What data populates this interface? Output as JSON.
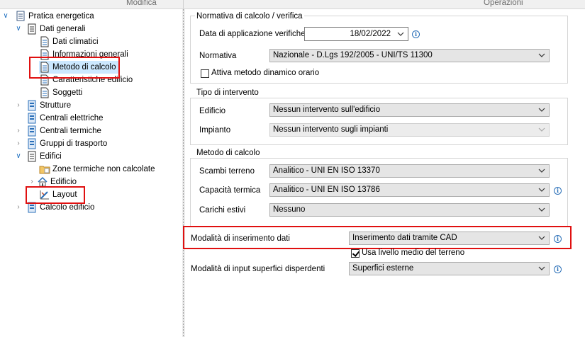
{
  "header": {
    "left_label": "Modifica",
    "right_label": "Operazioni"
  },
  "tree": {
    "items": [
      {
        "label": "Pratica energetica",
        "icon": "pratica-icon"
      },
      {
        "label": "Dati generali",
        "icon": "document-icon"
      },
      {
        "label": "Dati climatici",
        "icon": "document-icon"
      },
      {
        "label": "Informazioni generali",
        "icon": "document-icon"
      },
      {
        "label": "Metodo di calcolo",
        "icon": "document-icon"
      },
      {
        "label": "Caratteristiche edificio",
        "icon": "document-icon"
      },
      {
        "label": "Soggetti",
        "icon": "document-icon"
      },
      {
        "label": "Strutture",
        "icon": "module-icon"
      },
      {
        "label": "Centrali elettriche",
        "icon": "module-icon"
      },
      {
        "label": "Centrali termiche",
        "icon": "module-icon"
      },
      {
        "label": "Gruppi di trasporto",
        "icon": "module-icon"
      },
      {
        "label": "Edifici",
        "icon": "document-icon"
      },
      {
        "label": "Zone termiche non calcolate",
        "icon": "folder-icon"
      },
      {
        "label": "Edificio",
        "icon": "house-icon"
      },
      {
        "label": "Layout",
        "icon": "layout-icon"
      },
      {
        "label": "Calcolo edificio",
        "icon": "module-icon"
      }
    ]
  },
  "normativa": {
    "title": "Normativa di calcolo / verifica",
    "date_label": "Data di applicazione verifiche",
    "date_value": "18/02/2022",
    "norm_label": "Normativa",
    "norm_value": "Nazionale - D.Lgs 192/2005 - UNI/TS 11300",
    "dyn_label": "Attiva metodo dinamico orario",
    "dyn_checked": false
  },
  "intervento": {
    "title": "Tipo di intervento",
    "edificio_label": "Edificio",
    "edificio_value": "Nessun intervento sull'edificio",
    "impianto_label": "Impianto",
    "impianto_value": "Nessun intervento sugli impianti"
  },
  "metodo": {
    "title": "Metodo di calcolo",
    "scambi_label": "Scambi terreno",
    "scambi_value": "Analitico - UNI EN ISO 13370",
    "capacita_label": "Capacità termica",
    "capacita_value": "Analitico - UNI EN ISO 13786",
    "carichi_label": "Carichi estivi",
    "carichi_value": "Nessuno"
  },
  "inserimento": {
    "label": "Modalità di inserimento dati",
    "value": "Inserimento dati tramite CAD",
    "terreno_label": "Usa livello medio del terreno",
    "terreno_checked": true,
    "input_label": "Modalità di input superfici disperdenti",
    "input_value": "Superfici esterne"
  },
  "colors": {
    "highlight": "#e01010",
    "accent": "#2a6fb8",
    "selected_bg": "#cce8ff"
  }
}
